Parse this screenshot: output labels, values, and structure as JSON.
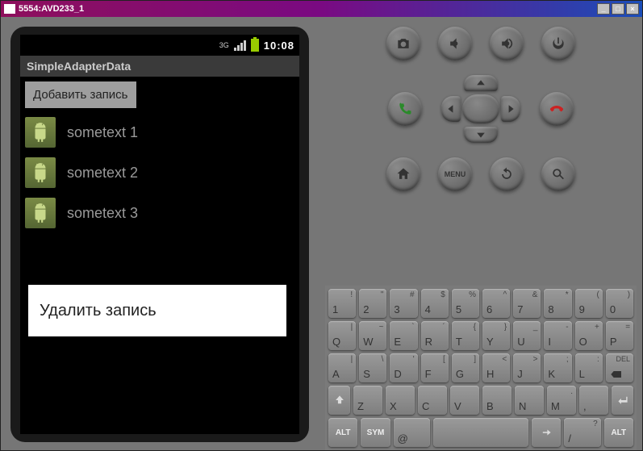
{
  "window": {
    "title": "5554:AVD233_1"
  },
  "phone": {
    "status": {
      "net": "3G",
      "clock": "10:08"
    },
    "appTitle": "SimpleAdapterData",
    "addButton": "Добавить запись",
    "items": [
      {
        "label": "sometext 1"
      },
      {
        "label": "sometext 2"
      },
      {
        "label": "sometext 3"
      }
    ],
    "contextMenu": "Удалить запись"
  },
  "buttons": {
    "menu": "MENU",
    "alt": "ALT",
    "sym": "SYM",
    "del": "DEL"
  },
  "keyboard": {
    "row1": [
      {
        "main": "1",
        "alt": "!"
      },
      {
        "main": "2",
        "alt": "\""
      },
      {
        "main": "3",
        "alt": "#"
      },
      {
        "main": "4",
        "alt": "$"
      },
      {
        "main": "5",
        "alt": "%"
      },
      {
        "main": "6",
        "alt": "^"
      },
      {
        "main": "7",
        "alt": "&"
      },
      {
        "main": "8",
        "alt": "*"
      },
      {
        "main": "9",
        "alt": "("
      },
      {
        "main": "0",
        "alt": ")"
      }
    ],
    "row2": [
      {
        "main": "Q",
        "alt": "|"
      },
      {
        "main": "W",
        "alt": "~"
      },
      {
        "main": "E",
        "alt": "`"
      },
      {
        "main": "R",
        "alt": "´"
      },
      {
        "main": "T",
        "alt": "{"
      },
      {
        "main": "Y",
        "alt": "}"
      },
      {
        "main": "U",
        "alt": "_"
      },
      {
        "main": "I",
        "alt": "-"
      },
      {
        "main": "O",
        "alt": "+"
      },
      {
        "main": "P",
        "alt": "="
      }
    ],
    "row3": [
      {
        "main": "A",
        "alt": "|"
      },
      {
        "main": "S",
        "alt": "\\"
      },
      {
        "main": "D",
        "alt": "'"
      },
      {
        "main": "F",
        "alt": "["
      },
      {
        "main": "G",
        "alt": "]"
      },
      {
        "main": "H",
        "alt": "<"
      },
      {
        "main": "J",
        "alt": ">"
      },
      {
        "main": "K",
        "alt": ";"
      },
      {
        "main": "L",
        "alt": ":"
      },
      {
        "main": "DEL",
        "alt": "DEL",
        "special": "del"
      }
    ],
    "row4": [
      {
        "main": "⇧",
        "special": "shift"
      },
      {
        "main": "Z",
        "alt": ""
      },
      {
        "main": "X",
        "alt": ""
      },
      {
        "main": "C",
        "alt": ""
      },
      {
        "main": "V",
        "alt": ""
      },
      {
        "main": "B",
        "alt": ""
      },
      {
        "main": "N",
        "alt": ""
      },
      {
        "main": "M",
        "alt": "."
      },
      {
        "main": ",",
        "alt": ""
      },
      {
        "main": "↵",
        "special": "enter"
      }
    ],
    "row5": [
      {
        "main": "ALT",
        "special": "alt"
      },
      {
        "main": "SYM",
        "special": "sym"
      },
      {
        "main": "@",
        "alt": ""
      },
      {
        "main": "",
        "special": "space",
        "wide": true
      },
      {
        "main": "→",
        "special": "right"
      },
      {
        "main": "/",
        "alt": "?"
      },
      {
        "main": "ALT",
        "special": "alt"
      }
    ]
  }
}
